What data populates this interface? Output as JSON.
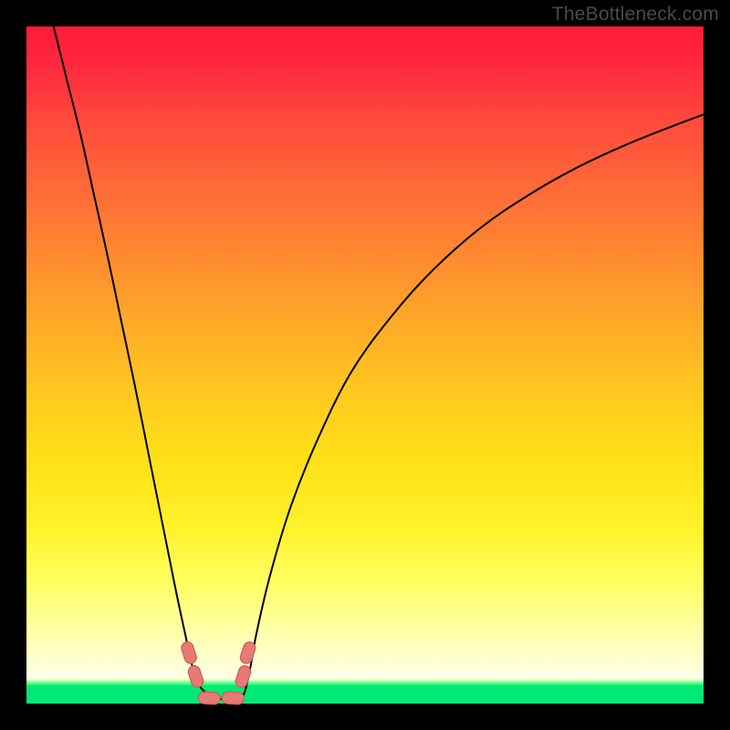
{
  "watermark": "TheBottleneck.com",
  "chart_data": {
    "type": "line",
    "title": "",
    "xlabel": "",
    "ylabel": "",
    "xlim": [
      0,
      100
    ],
    "ylim": [
      0,
      100
    ],
    "series": [
      {
        "name": "left-curve",
        "x": [
          4.0,
          6.0,
          8.0,
          10.0,
          12.0,
          14.0,
          16.0,
          18.0,
          20.0,
          22.0,
          23.5,
          24.5,
          25.5,
          27.0,
          28.5,
          30.5
        ],
        "y": [
          100.0,
          92.0,
          84.0,
          75.0,
          66.0,
          56.5,
          47.0,
          37.0,
          27.0,
          17.0,
          10.0,
          5.5,
          2.7,
          1.3,
          0.7,
          0.5
        ]
      },
      {
        "name": "right-curve",
        "x": [
          30.5,
          32.0,
          33.0,
          34.0,
          36.0,
          39.0,
          43.0,
          48.0,
          54.0,
          60.0,
          67.0,
          74.0,
          81.0,
          88.5,
          96.0,
          100.0
        ],
        "y": [
          0.5,
          1.2,
          5.0,
          10.5,
          19.0,
          29.0,
          39.0,
          49.0,
          57.3,
          64.0,
          70.2,
          75.0,
          79.0,
          82.5,
          85.5,
          87.0
        ]
      }
    ],
    "markers": [
      {
        "name": "bead-left-upper",
        "x": 24.0,
        "y": 7.5
      },
      {
        "name": "bead-left-lower",
        "x": 25.0,
        "y": 4.0
      },
      {
        "name": "bead-right-upper",
        "x": 32.7,
        "y": 7.5
      },
      {
        "name": "bead-right-lower",
        "x": 32.0,
        "y": 4.0
      },
      {
        "name": "bead-bottom-a",
        "x": 27.0,
        "y": 0.8
      },
      {
        "name": "bead-bottom-b",
        "x": 30.5,
        "y": 0.8
      }
    ],
    "gradient_bands": [
      {
        "color": "#ff1a3a",
        "stop": 0.0
      },
      {
        "color": "#ffaa28",
        "stop": 0.44
      },
      {
        "color": "#ffff60",
        "stop": 0.82
      },
      {
        "color": "#ffffe8",
        "stop": 0.963
      },
      {
        "color": "#00e876",
        "stop": 0.974
      }
    ]
  }
}
